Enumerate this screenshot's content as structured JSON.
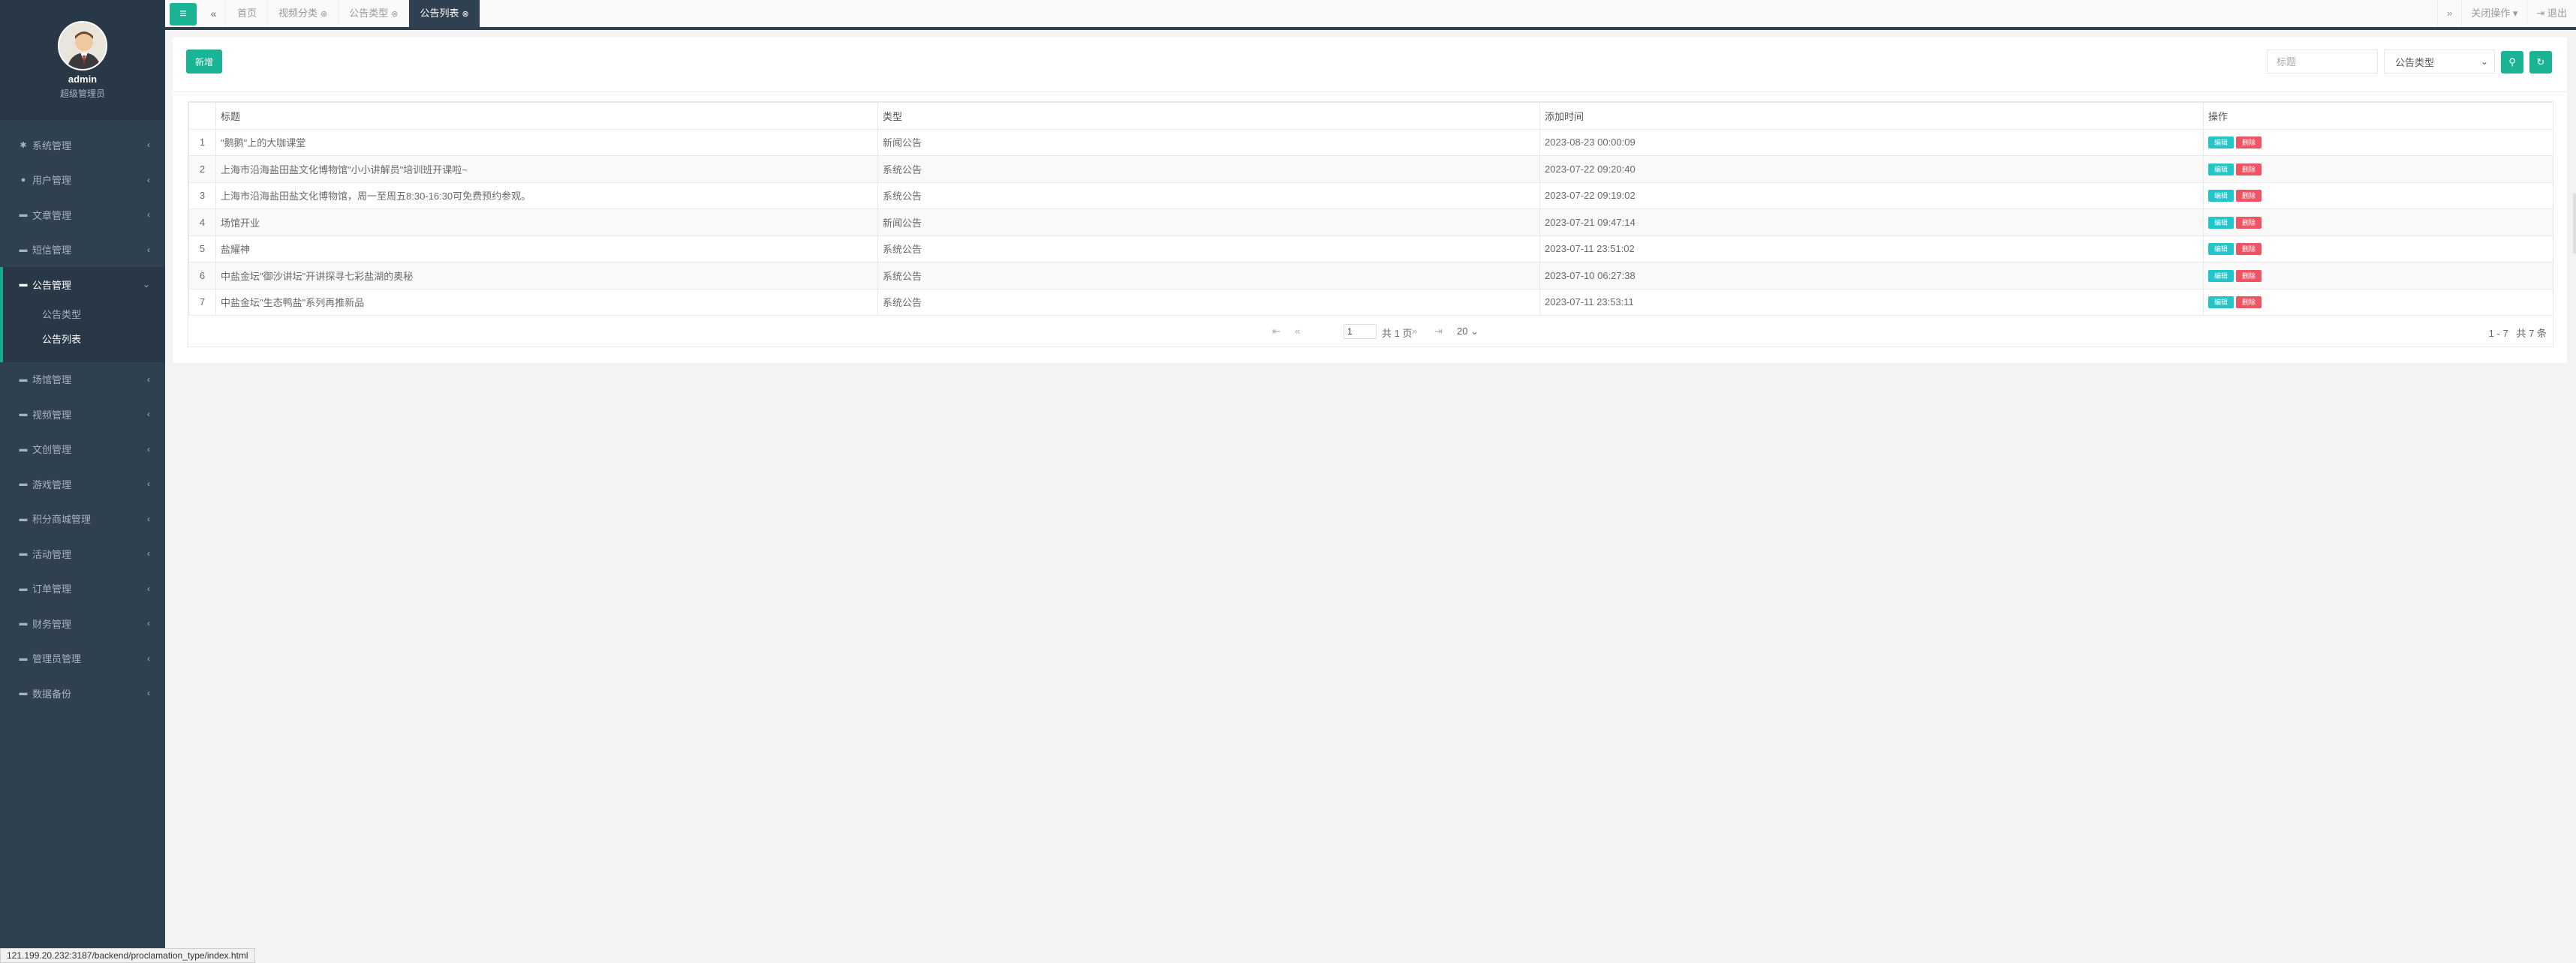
{
  "user": {
    "name": "admin",
    "role": "超级管理员"
  },
  "sidebar": {
    "items": [
      {
        "label": "系统管理",
        "icon": "gear-icon"
      },
      {
        "label": "用户管理",
        "icon": "user-icon"
      },
      {
        "label": "文章管理",
        "icon": "folder-icon"
      },
      {
        "label": "短信管理",
        "icon": "folder-icon"
      },
      {
        "label": "公告管理",
        "icon": "folder-icon",
        "sub": [
          "公告类型",
          "公告列表"
        ]
      },
      {
        "label": "场馆管理",
        "icon": "folder-icon"
      },
      {
        "label": "视频管理",
        "icon": "folder-icon"
      },
      {
        "label": "文创管理",
        "icon": "folder-icon"
      },
      {
        "label": "游戏管理",
        "icon": "folder-icon"
      },
      {
        "label": "积分商城管理",
        "icon": "folder-icon"
      },
      {
        "label": "活动管理",
        "icon": "folder-icon"
      },
      {
        "label": "订单管理",
        "icon": "folder-icon"
      },
      {
        "label": "财务管理",
        "icon": "folder-icon"
      },
      {
        "label": "管理员管理",
        "icon": "folder-icon"
      },
      {
        "label": "数据备份",
        "icon": "folder-icon"
      }
    ]
  },
  "tabs": [
    {
      "label": "首页"
    },
    {
      "label": "视频分类"
    },
    {
      "label": "公告类型"
    },
    {
      "label": "公告列表"
    }
  ],
  "topbar": {
    "close_ops": "关闭操作",
    "logout": "退出"
  },
  "toolbar": {
    "add_label": "新增",
    "title_placeholder": "标题",
    "type_select": "公告类型"
  },
  "table": {
    "headers": [
      "标题",
      "类型",
      "添加时间",
      "操作"
    ],
    "rows": [
      {
        "n": "1",
        "title": "\"鹅鹅\"上的大咖课堂",
        "type": "新闻公告",
        "time": "2023-08-23 00:00:09"
      },
      {
        "n": "2",
        "title": "上海市沿海盐田盐文化博物馆\"小小讲解员\"培训班开课啦~",
        "type": "系统公告",
        "time": "2023-07-22 09:20:40"
      },
      {
        "n": "3",
        "title": "上海市沿海盐田盐文化博物馆，周一至周五8:30-16:30可免费预约参观。",
        "type": "系统公告",
        "time": "2023-07-22 09:19:02"
      },
      {
        "n": "4",
        "title": "场馆开业",
        "type": "新闻公告",
        "time": "2023-07-21 09:47:14"
      },
      {
        "n": "5",
        "title": "盐耀神",
        "type": "系统公告",
        "time": "2023-07-11 23:51:02"
      },
      {
        "n": "6",
        "title": "中盐金坛\"御沙讲坛\"开讲探寻七彩盐湖的奥秘",
        "type": "系统公告",
        "time": "2023-07-10 06:27:38"
      },
      {
        "n": "7",
        "title": "中盐金坛\"生态鸭盐\"系列再推新品",
        "type": "系统公告",
        "time": "2023-07-11 23:53:11"
      }
    ],
    "edit_label": "编辑",
    "delete_label": "删除"
  },
  "pager": {
    "page": "1",
    "total_pages": "共 1 页",
    "page_size": "20",
    "range": "1 - 7",
    "total": "共 7 条"
  },
  "status_url": "121.199.20.232:3187/backend/proclamation_type/index.html",
  "colors": {
    "accent": "#1ab394",
    "sidebar": "#2f4050",
    "edit": "#23c6c8",
    "delete": "#ed5565"
  }
}
